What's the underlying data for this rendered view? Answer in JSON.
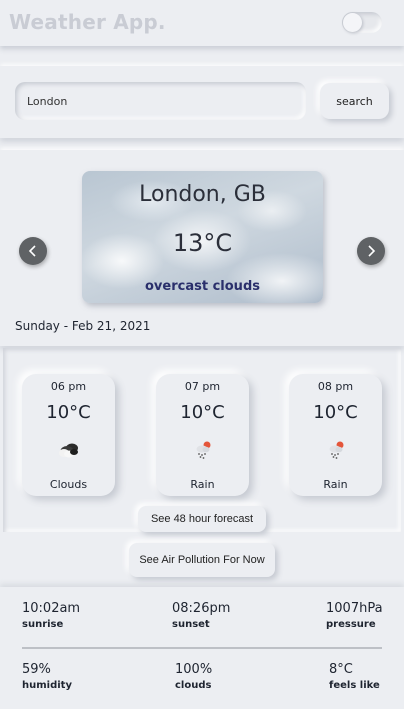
{
  "header": {
    "title": "Weather App."
  },
  "search": {
    "value": "London",
    "button_label": "search"
  },
  "current": {
    "city": "London, GB",
    "temperature": "13°C",
    "description": "overcast clouds",
    "date": "Sunday - Feb 21, 2021"
  },
  "hourly": [
    {
      "time": "06 pm",
      "temp": "10°C",
      "condition": "Clouds",
      "icon": "clouds-icon"
    },
    {
      "time": "07 pm",
      "temp": "10°C",
      "condition": "Rain",
      "icon": "rain-icon"
    },
    {
      "time": "08 pm",
      "temp": "10°C",
      "condition": "Rain",
      "icon": "rain-icon"
    }
  ],
  "buttons": {
    "forecast_48": "See 48 hour forecast",
    "air_pollution": "See Air Pollution For Now"
  },
  "details": {
    "sunrise": {
      "value": "10:02am",
      "label": "sunrise"
    },
    "sunset": {
      "value": "08:26pm",
      "label": "sunset"
    },
    "pressure": {
      "value": "1007hPa",
      "label": "pressure"
    },
    "humidity": {
      "value": "59%",
      "label": "humidity"
    },
    "clouds": {
      "value": "100%",
      "label": "clouds"
    },
    "feels_like": {
      "value": "8°C",
      "label": "feels like"
    }
  },
  "colors": {
    "background": "#eceef2",
    "title_muted": "#c9ccd4",
    "description": "#2a2f6b",
    "nav_button": "#5f6265",
    "rain_sun_accent": "#e4553a"
  }
}
